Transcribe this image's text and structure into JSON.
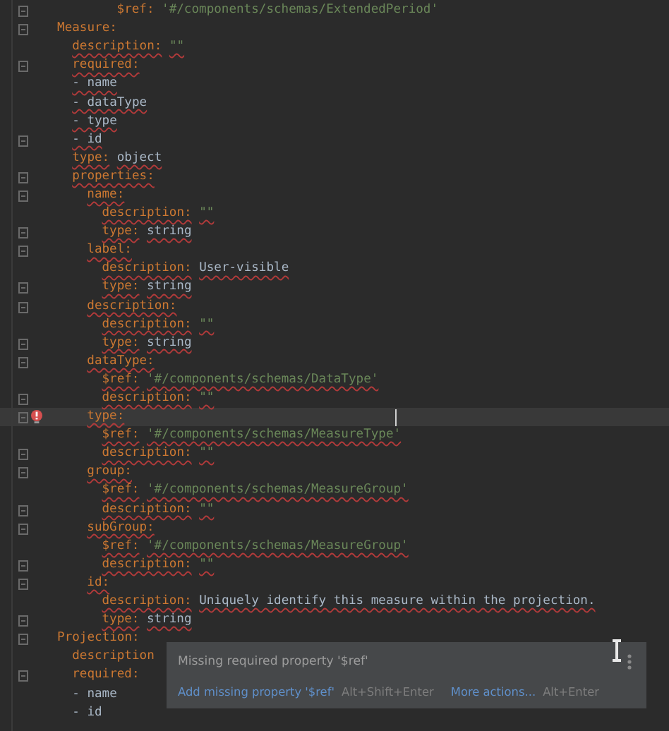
{
  "editor": {
    "lines": [
      {
        "kind": "pair",
        "key": "          $ref:",
        "value": "'#/components/schemas/ExtendedPeriod'",
        "string_value": true,
        "squiggle": false,
        "fold": true,
        "current": false,
        "error": false
      },
      {
        "kind": "pair",
        "key": "  Measure:",
        "squiggle": false,
        "fold": true,
        "current": false,
        "error": false
      },
      {
        "kind": "pair",
        "key": "    description:",
        "value": "\"\"",
        "string_value": true,
        "squiggle": true,
        "fold": false,
        "current": false,
        "error": false
      },
      {
        "kind": "pair",
        "key": "    required:",
        "squiggle": true,
        "fold": true,
        "current": false,
        "error": false
      },
      {
        "kind": "item",
        "key": "    - name",
        "squiggle": true,
        "fold": false,
        "current": false,
        "error": false
      },
      {
        "kind": "item",
        "key": "    - dataType",
        "squiggle": true,
        "fold": false,
        "current": false,
        "error": false
      },
      {
        "kind": "item",
        "key": "    - type",
        "squiggle": true,
        "fold": false,
        "current": false,
        "error": false
      },
      {
        "kind": "item",
        "key": "    - id",
        "squiggle": true,
        "fold": true,
        "current": false,
        "error": false
      },
      {
        "kind": "pair",
        "key": "    type:",
        "value": "object",
        "string_value": false,
        "squiggle": true,
        "fold": false,
        "current": false,
        "error": false
      },
      {
        "kind": "pair",
        "key": "    properties:",
        "squiggle": true,
        "fold": true,
        "current": false,
        "error": false
      },
      {
        "kind": "pair",
        "key": "      name:",
        "squiggle": true,
        "fold": true,
        "current": false,
        "error": false
      },
      {
        "kind": "pair",
        "key": "        description:",
        "value": "\"\"",
        "string_value": true,
        "squiggle": true,
        "fold": false,
        "current": false,
        "error": false
      },
      {
        "kind": "pair",
        "key": "        type:",
        "value": "string",
        "string_value": false,
        "squiggle": true,
        "fold": true,
        "current": false,
        "error": false
      },
      {
        "kind": "pair",
        "key": "      label:",
        "squiggle": true,
        "fold": true,
        "current": false,
        "error": false
      },
      {
        "kind": "pair",
        "key": "        description:",
        "value": "User-visible",
        "string_value": false,
        "squiggle": true,
        "fold": false,
        "current": false,
        "error": false
      },
      {
        "kind": "pair",
        "key": "        type:",
        "value": "string",
        "string_value": false,
        "squiggle": true,
        "fold": true,
        "current": false,
        "error": false
      },
      {
        "kind": "pair",
        "key": "      description:",
        "squiggle": true,
        "fold": true,
        "current": false,
        "error": false
      },
      {
        "kind": "pair",
        "key": "        description:",
        "value": "\"\"",
        "string_value": true,
        "squiggle": true,
        "fold": false,
        "current": false,
        "error": false
      },
      {
        "kind": "pair",
        "key": "        type:",
        "value": "string",
        "string_value": false,
        "squiggle": true,
        "fold": true,
        "current": false,
        "error": false
      },
      {
        "kind": "pair",
        "key": "      dataType:",
        "squiggle": true,
        "fold": true,
        "current": false,
        "error": false
      },
      {
        "kind": "pair",
        "key": "        $ref:",
        "value": "'#/components/schemas/DataType'",
        "string_value": true,
        "squiggle": true,
        "fold": false,
        "current": false,
        "error": false
      },
      {
        "kind": "pair",
        "key": "        description:",
        "value": "\"\"",
        "string_value": true,
        "squiggle": true,
        "fold": true,
        "current": false,
        "error": false
      },
      {
        "kind": "pair",
        "key": "      type:",
        "squiggle": true,
        "fold": true,
        "current": true,
        "error": true
      },
      {
        "kind": "pair",
        "key": "        $ref:",
        "value": "'#/components/schemas/MeasureType'",
        "string_value": true,
        "squiggle": true,
        "fold": false,
        "current": false,
        "error": false
      },
      {
        "kind": "pair",
        "key": "        description:",
        "value": "\"\"",
        "string_value": true,
        "squiggle": true,
        "fold": true,
        "current": false,
        "error": false
      },
      {
        "kind": "pair",
        "key": "      group:",
        "squiggle": true,
        "fold": true,
        "current": false,
        "error": false
      },
      {
        "kind": "pair",
        "key": "        $ref:",
        "value": "'#/components/schemas/MeasureGroup'",
        "string_value": true,
        "squiggle": true,
        "fold": false,
        "current": false,
        "error": false
      },
      {
        "kind": "pair",
        "key": "        description:",
        "value": "\"\"",
        "string_value": true,
        "squiggle": true,
        "fold": true,
        "current": false,
        "error": false
      },
      {
        "kind": "pair",
        "key": "      subGroup:",
        "squiggle": true,
        "fold": true,
        "current": false,
        "error": false
      },
      {
        "kind": "pair",
        "key": "        $ref:",
        "value": "'#/components/schemas/MeasureGroup'",
        "string_value": true,
        "squiggle": true,
        "fold": false,
        "current": false,
        "error": false
      },
      {
        "kind": "pair",
        "key": "        description:",
        "value": "\"\"",
        "string_value": true,
        "squiggle": true,
        "fold": true,
        "current": false,
        "error": false
      },
      {
        "kind": "pair",
        "key": "      id:",
        "squiggle": true,
        "fold": true,
        "current": false,
        "error": false
      },
      {
        "kind": "pair",
        "key": "        description:",
        "value": "Uniquely identify this measure within the projection.",
        "string_value": false,
        "squiggle": true,
        "fold": false,
        "current": false,
        "error": false
      },
      {
        "kind": "pair",
        "key": "        type:",
        "value": "string",
        "string_value": false,
        "squiggle": true,
        "fold": true,
        "current": false,
        "error": false
      },
      {
        "kind": "pair",
        "key": "  Projection:",
        "squiggle": false,
        "fold": true,
        "current": false,
        "error": false
      },
      {
        "kind": "pair",
        "key": "    description",
        "squiggle": false,
        "fold": false,
        "current": false,
        "error": false
      },
      {
        "kind": "pair",
        "key": "    required:",
        "squiggle": false,
        "fold": true,
        "current": false,
        "error": false
      },
      {
        "kind": "item",
        "key": "    - name",
        "squiggle": false,
        "fold": false,
        "current": false,
        "error": false
      },
      {
        "kind": "item",
        "key": "    - id",
        "squiggle": false,
        "fold": false,
        "current": false,
        "error": false
      }
    ]
  },
  "popup": {
    "message": "Missing required property '$ref'",
    "actions": [
      {
        "label": "Add missing property '$ref'",
        "shortcut": "Alt+Shift+Enter"
      },
      {
        "label": "More actions...",
        "shortcut": "Alt+Enter"
      }
    ]
  }
}
